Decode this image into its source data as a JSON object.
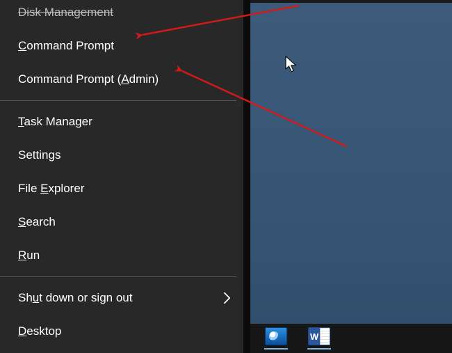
{
  "menu": {
    "items": {
      "disk_management": "Disk Management",
      "command_prompt_pre": "",
      "command_prompt_u": "C",
      "command_prompt_post": "ommand Prompt",
      "command_prompt_admin_pre": "Command Prompt (",
      "command_prompt_admin_u": "A",
      "command_prompt_admin_post": "dmin)",
      "task_manager_pre": "",
      "task_manager_u": "T",
      "task_manager_post": "ask Manager",
      "settings_pre": "Settin",
      "settings_u": "g",
      "settings_post": "s",
      "file_explorer_pre": "File ",
      "file_explorer_u": "E",
      "file_explorer_post": "xplorer",
      "search_pre": "",
      "search_u": "S",
      "search_post": "earch",
      "run_pre": "",
      "run_u": "R",
      "run_post": "un",
      "shutdown_pre": "Sh",
      "shutdown_u": "u",
      "shutdown_post": "t down or sign out",
      "desktop_pre": "",
      "desktop_u": "D",
      "desktop_post": "esktop"
    }
  },
  "taskbar": {
    "word_letter": "W"
  },
  "annotation_color": "#d11a1a"
}
